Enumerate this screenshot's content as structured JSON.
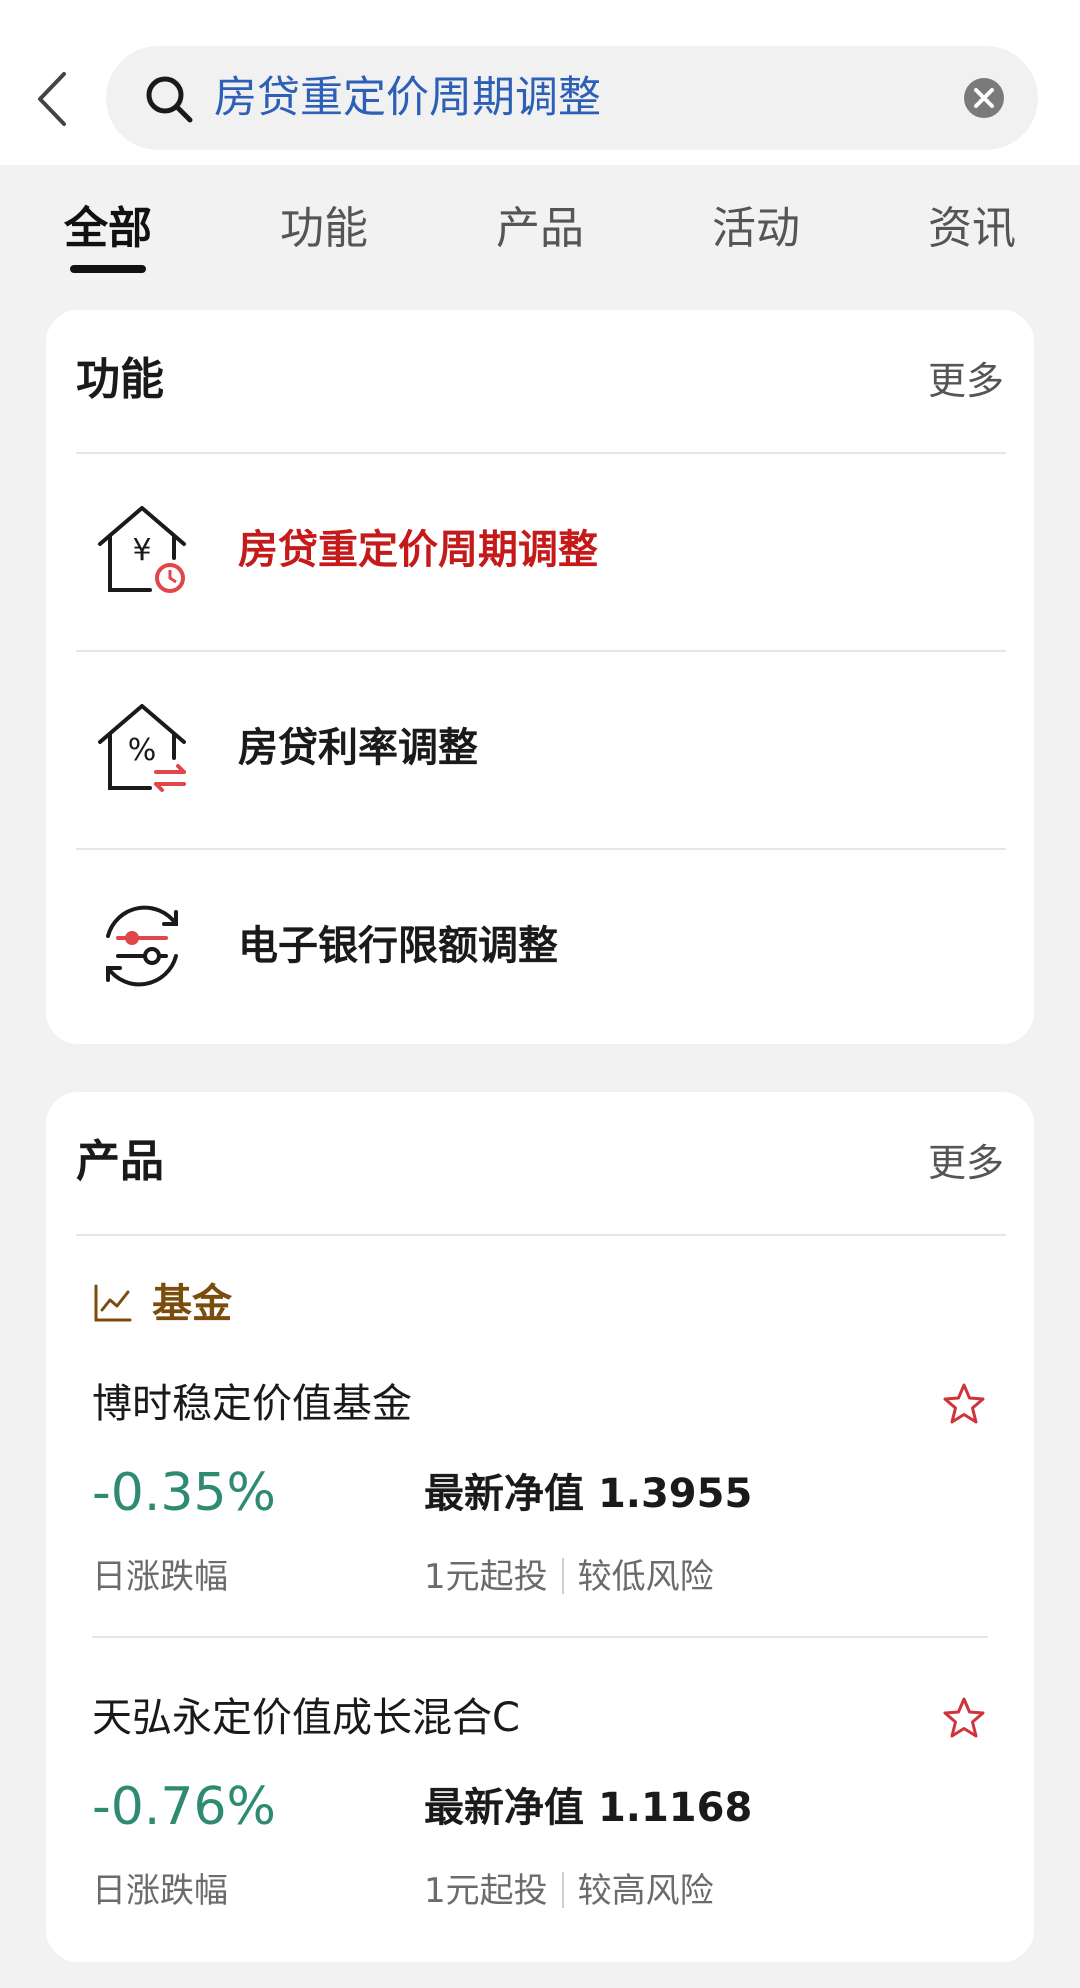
{
  "search": {
    "query": "房贷重定价周期调整"
  },
  "tabs": [
    {
      "label": "全部",
      "active": true
    },
    {
      "label": "功能",
      "active": false
    },
    {
      "label": "产品",
      "active": false
    },
    {
      "label": "活动",
      "active": false
    },
    {
      "label": "资讯",
      "active": false
    }
  ],
  "functions_section": {
    "title": "功能",
    "more": "更多",
    "items": [
      {
        "label": "房贷重定价周期调整",
        "icon": "house-yuan-clock-icon",
        "highlighted": true
      },
      {
        "label": "房贷利率调整",
        "icon": "house-percent-exchange-icon",
        "highlighted": false
      },
      {
        "label": "电子银行限额调整",
        "icon": "limit-adjust-cycle-icon",
        "highlighted": false
      }
    ]
  },
  "products_section": {
    "title": "产品",
    "more": "更多",
    "category": {
      "label": "基金",
      "icon": "trend-chart-icon"
    },
    "funds": [
      {
        "name": "博时稳定价值基金",
        "change": "-0.35%",
        "change_label": "日涨跌幅",
        "nav_label": "最新净值",
        "nav_value": "1.3955",
        "min_invest": "1元起投",
        "risk": "较低风险"
      },
      {
        "name": "天弘永定价值成长混合C",
        "change": "-0.76%",
        "change_label": "日涨跌幅",
        "nav_label": "最新净值",
        "nav_value": "1.1168",
        "min_invest": "1元起投",
        "risk": "较高风险"
      }
    ]
  },
  "colors": {
    "highlight_red": "#c41a1a",
    "change_green": "#2f8a72",
    "category_brown": "#7a4d0e",
    "query_blue": "#2c5fb5"
  }
}
